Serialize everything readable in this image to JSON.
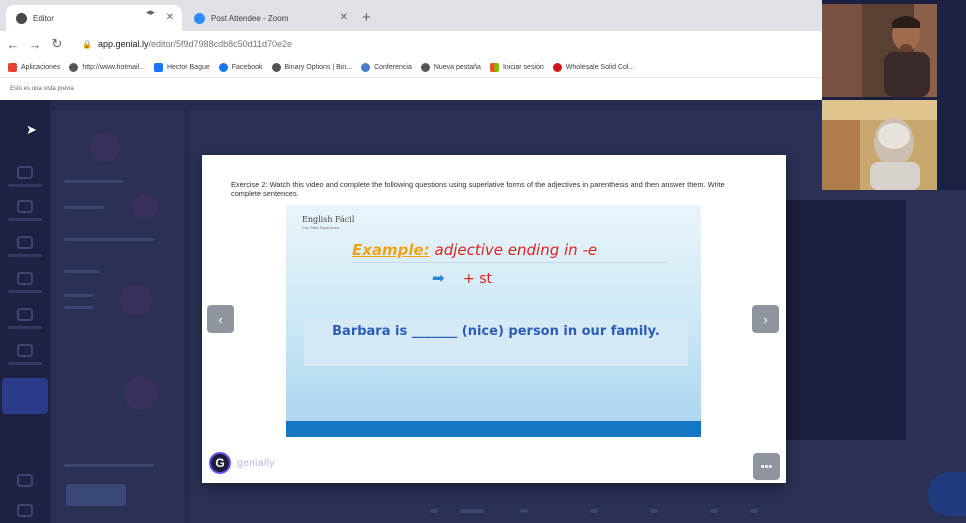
{
  "browser": {
    "tabs": [
      {
        "title": "Editor",
        "favicon_color": "#4a4a4a"
      },
      {
        "title": "Post Attendee - Zoom",
        "favicon_color": "#2d8cff"
      }
    ],
    "new_tab_label": "+",
    "url_host": "app.genial.ly",
    "url_path": "/editor/5f9d7988cdb8c50d11d70e2e",
    "bookmarks": [
      {
        "label": "Aplicaciones",
        "color": "#e34133"
      },
      {
        "label": "http://www.hotmail...",
        "color": "#555555"
      },
      {
        "label": "Hector Bague",
        "color": "#1877f2"
      },
      {
        "label": "Facebook",
        "color": "#1877f2"
      },
      {
        "label": "Binary Options | Bin...",
        "color": "#555555"
      },
      {
        "label": "Conferencia",
        "color": "#4a7bc8"
      },
      {
        "label": "Nueva pestaña",
        "color": "#555555"
      },
      {
        "label": "Iniciar sesión",
        "color": "#f25022"
      },
      {
        "label": "Wholesale Solid Col...",
        "color": "#cc1a1a"
      }
    ],
    "preview_notice": "Esto es una vista previa"
  },
  "modal": {
    "exercise_text": "Exercise 2: Watch this video and complete the following questions using superlative forms of the adjectives in parenthesis and then answer them. Write complete sentences.",
    "slide": {
      "brand": "English Fácil",
      "brand_sub": "Con Miss Esperanza",
      "example_label": "Example:",
      "example_rest": "adjective ending in -e",
      "arrow_text": "+ st",
      "sentence": "Barbara is _______ (nice) person in our family."
    },
    "prev_label": "‹",
    "next_label": "›",
    "more_label": "•••",
    "logo_letter": "G",
    "logo_word": "genially"
  }
}
